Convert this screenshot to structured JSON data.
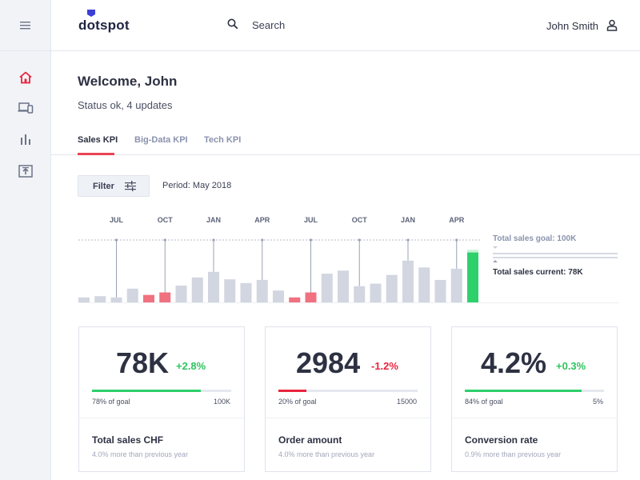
{
  "app": {
    "logo_text": "dotspot"
  },
  "topbar": {
    "search_label": "Search",
    "user_name": "John Smith"
  },
  "sidebar": {
    "items": [
      {
        "name": "home",
        "active": true
      },
      {
        "name": "devices",
        "active": false
      },
      {
        "name": "analytics",
        "active": false
      },
      {
        "name": "upload",
        "active": false
      }
    ]
  },
  "main": {
    "welcome": "Welcome, John",
    "status": "Status ok, 4 updates",
    "tabs": [
      {
        "label": "Sales KPI",
        "active": true
      },
      {
        "label": "Big-Data KPI",
        "active": false
      },
      {
        "label": "Tech KPI",
        "active": false
      }
    ],
    "filter_label": "Filter",
    "period": "Period: May 2018"
  },
  "chart_data": {
    "type": "bar",
    "month_markers": [
      "JUL",
      "OCT",
      "JAN",
      "APR",
      "JUL",
      "OCT",
      "JAN",
      "APR"
    ],
    "values": [
      8,
      10,
      8,
      22,
      12,
      16,
      27,
      40,
      49,
      37,
      31,
      36,
      19,
      8,
      16,
      46,
      51,
      26,
      30,
      44,
      67,
      56,
      36,
      54,
      80
    ],
    "highlight": [
      false,
      false,
      false,
      false,
      true,
      true,
      false,
      false,
      false,
      false,
      false,
      false,
      false,
      true,
      true,
      false,
      false,
      false,
      false,
      false,
      false,
      false,
      false,
      false,
      false
    ],
    "current_index": 24,
    "goal_value": 100,
    "current_value": 78,
    "goal_label": "Total sales goal: 100K",
    "current_label": "Total sales current: 78K",
    "colors": {
      "normal": "#d2d6e0",
      "highlight": "#f0717f",
      "current": "#2ed06b",
      "goal": "#c8f2d6"
    }
  },
  "cards": [
    {
      "value": "78K",
      "delta": "+2.8%",
      "delta_color": "#2ec45f",
      "progress": 0.78,
      "bar_color": "#2ed06b",
      "goal_text": "78% of goal",
      "target": "100K",
      "title": "Total sales CHF",
      "subtitle": "4.0% more than previous year"
    },
    {
      "value": "2984",
      "delta": "-1.2%",
      "delta_color": "#e8233d",
      "progress": 0.2,
      "bar_color": "#e8233d",
      "goal_text": "20% of goal",
      "target": "15000",
      "title": "Order amount",
      "subtitle": "4.0% more than previous year"
    },
    {
      "value": "4.2%",
      "delta": "+0.3%",
      "delta_color": "#2ec45f",
      "progress": 0.84,
      "bar_color": "#2ed06b",
      "goal_text": "84% of goal",
      "target": "5%",
      "title": "Conversion rate",
      "subtitle": "0.9% more than previous year"
    }
  ],
  "colors": {
    "accent": "#e84455",
    "positive": "#2ec45f",
    "negative": "#e8233d"
  }
}
